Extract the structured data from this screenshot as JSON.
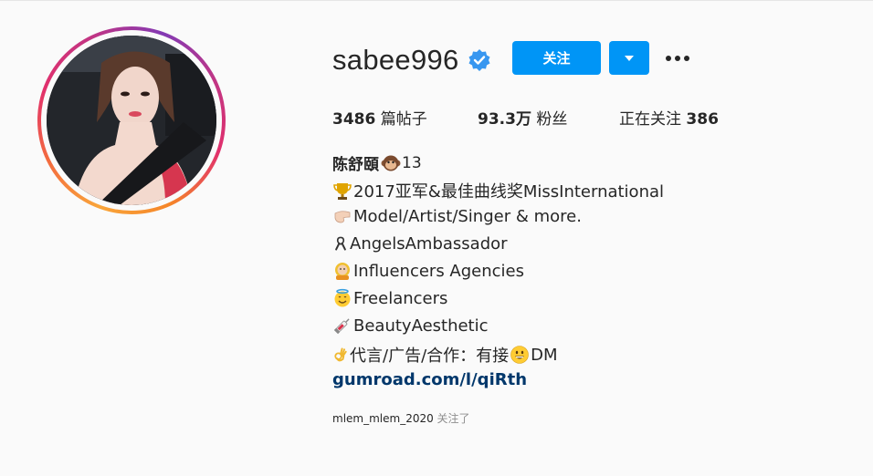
{
  "profile": {
    "username": "sabee996",
    "verified": true,
    "follow_label": "关注",
    "stats": {
      "posts_count": "3486",
      "posts_label": " 篇帖子",
      "followers_count": "93.3万",
      "followers_label": " 粉丝",
      "following_label": "正在关注 ",
      "following_count": "386"
    },
    "display_name": "陈舒頤",
    "display_name_suffix": "13",
    "bio_lines": [
      "2017亚军&最佳曲线奖MissInternational",
      "Model/Artist/Singer & more.",
      "AngelsAmbassador",
      "Influencers Agencies",
      "Freelancers",
      "BeautyAesthetic",
      "代言/广告/合作：有接",
      "DM"
    ],
    "website": "gumroad.com/l/qiRth",
    "followed_by_user": "mlem_mlem_2020",
    "followed_by_suffix": " 关注了"
  },
  "icons": {
    "verified": "verified-badge-icon",
    "dropdown": "chevron-down-icon",
    "more": "more-options-icon",
    "line_emojis": [
      "trophy-icon",
      "hand-icon",
      "ribbon-icon",
      "astronaut-icon",
      "halo-smile-icon",
      "syringe-icon",
      "ok-hand-icon",
      "grin-icon"
    ],
    "name_emoji": "monkey-icon"
  },
  "colors": {
    "accent": "#0095f6",
    "link": "#00376b",
    "text": "#262626",
    "muted": "#8e8e8e",
    "background": "#fafafa"
  }
}
